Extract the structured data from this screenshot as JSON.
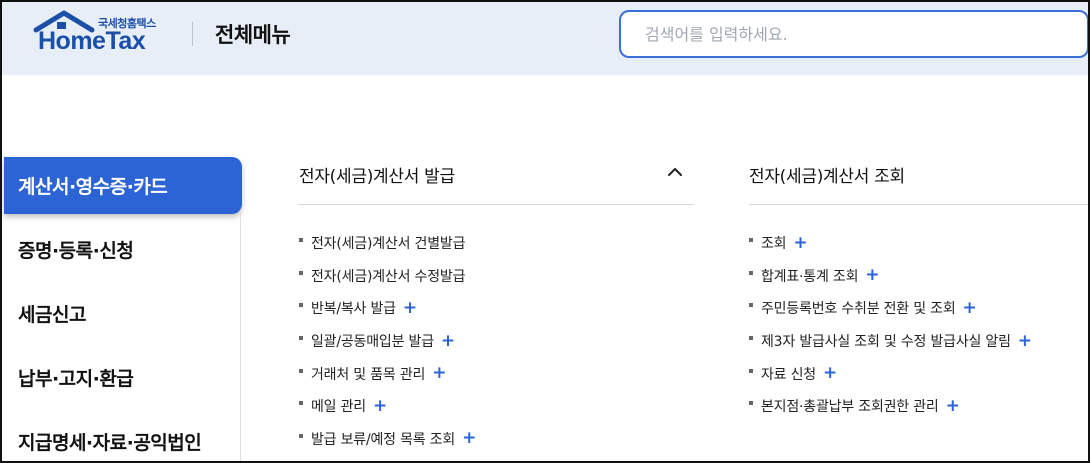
{
  "header": {
    "logo_sub": "국세청홈택스",
    "logo_main": "HomeTax",
    "title": "전체메뉴",
    "search_placeholder": "검색어를 입력하세요."
  },
  "nav": {
    "items": [
      {
        "label": "계산서·영수증·카드",
        "active": true
      },
      {
        "label": "증명·등록·신청",
        "active": false
      },
      {
        "label": "세금신고",
        "active": false
      },
      {
        "label": "납부·고지·환급",
        "active": false
      },
      {
        "label": "지급명세·자료·공익법인",
        "active": false
      }
    ]
  },
  "left_column": {
    "title": "전자(세금)계산서 발급",
    "items": [
      {
        "label": "전자(세금)계산서 건별발급",
        "plus": ""
      },
      {
        "label": "전자(세금)계산서 수정발급",
        "plus": ""
      },
      {
        "label": "반복/복사 발급",
        "plus": "+"
      },
      {
        "label": "일괄/공동매입분 발급",
        "plus": "+"
      },
      {
        "label": "거래처 및 품목 관리",
        "plus": "+"
      },
      {
        "label": "메일 관리",
        "plus": "+"
      },
      {
        "label": "발급 보류/예정 목록 조회",
        "plus": "+"
      }
    ]
  },
  "right_column": {
    "title": "전자(세금)계산서 조회",
    "items": [
      {
        "label": "조회",
        "plus": "+"
      },
      {
        "label": "합계표·통계 조회",
        "plus": "+"
      },
      {
        "label": "주민등록번호 수취분 전환 및 조회",
        "plus": "+"
      },
      {
        "label": "제3자 발급사실 조회 및 수정 발급사실 알림",
        "plus": "+"
      },
      {
        "label": "자료 신청",
        "plus": "+"
      },
      {
        "label": "본지점·총괄납부 조회권한 관리",
        "plus": "+"
      }
    ]
  },
  "colors": {
    "accent": "#2c64d6",
    "header_bg": "#e8eef7",
    "logo_blue": "#1b4fa8"
  },
  "icons": {
    "logo": "house-roof-icon",
    "collapse": "chevron-up-icon",
    "bullet": "square-bullet-icon",
    "expand": "plus-icon"
  }
}
